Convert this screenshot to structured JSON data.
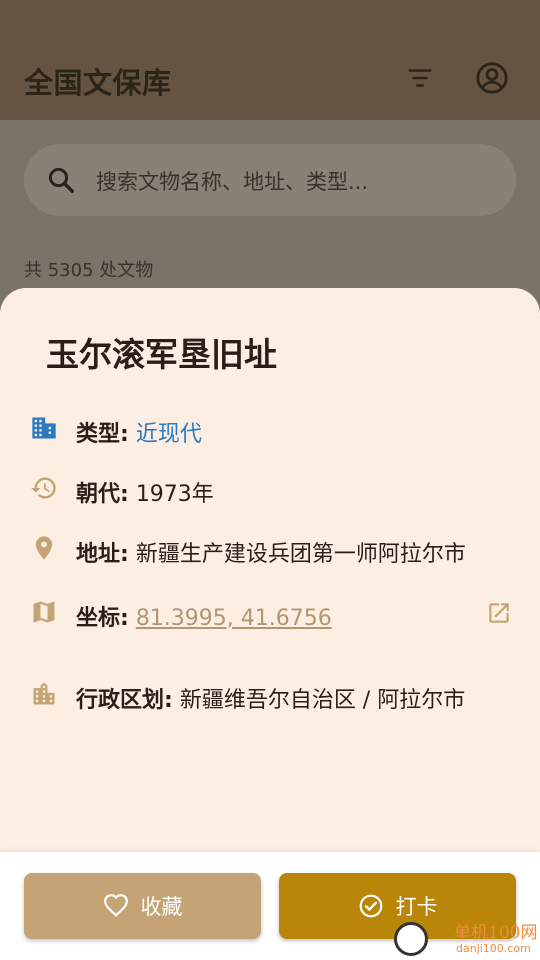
{
  "app_bar": {
    "title": "全国文保库",
    "filter_icon": "filter-icon",
    "account_icon": "account-circle-icon"
  },
  "search": {
    "placeholder": "搜索文物名称、地址、类型..."
  },
  "list": {
    "count_text": "共 5305 处文物"
  },
  "detail": {
    "title": "玉尔滚军垦旧址",
    "rows": [
      {
        "icon": "building-icon",
        "label": "类型:",
        "value": "近现代"
      },
      {
        "icon": "history-icon",
        "label": "朝代:",
        "value": "1973年"
      },
      {
        "icon": "location-pin-icon",
        "label": "地址:",
        "value": "新疆生产建设兵团第一师阿拉尔市"
      },
      {
        "icon": "map-icon",
        "label": "坐标:",
        "value": "81.3995, 41.6756"
      },
      {
        "icon": "city-icon",
        "label": "行政区划:",
        "value": "新疆维吾尔自治区 / 阿拉尔市"
      }
    ]
  },
  "actions": {
    "favorite": "收藏",
    "checkin": "打卡"
  },
  "watermark": {
    "brand": "单机100网",
    "url": "danji100.com"
  },
  "colors": {
    "app_bar": "#655442",
    "sheet": "#fdeee4",
    "link_blue": "#2b7ac0",
    "favorite_button": "#c4a474",
    "checkin_button": "#b9860a"
  }
}
